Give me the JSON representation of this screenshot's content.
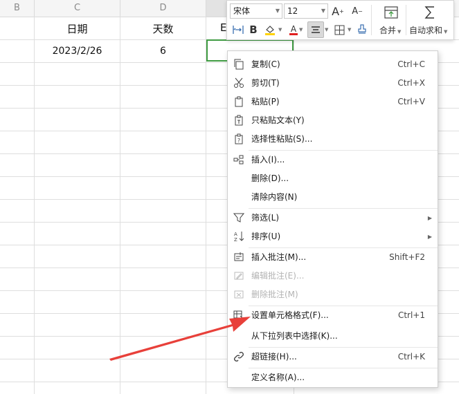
{
  "columns": {
    "b": "B",
    "c": "C",
    "d": "D"
  },
  "headers": {
    "date": "日期",
    "days": "天数",
    "partial": "E"
  },
  "row": {
    "date": "2023/2/26",
    "days": "6"
  },
  "toolbar": {
    "font_name": "宋体",
    "font_size": "12",
    "grow_font_glyph": "A",
    "shrink_font_glyph": "A",
    "bold_glyph": "B",
    "font_color_glyph": "A",
    "merge_label": "合并",
    "autosum_label": "自动求和",
    "font_color_bar": "#e02020",
    "fill_color_bar": "#ffd200"
  },
  "menu": {
    "items": [
      {
        "label": "复制(C)",
        "shortcut": "Ctrl+C"
      },
      {
        "label": "剪切(T)",
        "shortcut": "Ctrl+X"
      },
      {
        "label": "粘贴(P)",
        "shortcut": "Ctrl+V"
      },
      {
        "label": "只粘贴文本(Y)"
      },
      {
        "label": "选择性粘贴(S)..."
      },
      {
        "label": "插入(I)..."
      },
      {
        "label": "删除(D)..."
      },
      {
        "label": "清除内容(N)"
      },
      {
        "label": "筛选(L)"
      },
      {
        "label": "排序(U)"
      },
      {
        "label": "插入批注(M)...",
        "shortcut": "Shift+F2"
      },
      {
        "label": "编辑批注(E)..."
      },
      {
        "label": "删除批注(M)"
      },
      {
        "label": "设置单元格格式(F)...",
        "shortcut": "Ctrl+1"
      },
      {
        "label": "从下拉列表中选择(K)..."
      },
      {
        "label": "超链接(H)...",
        "shortcut": "Ctrl+K"
      },
      {
        "label": "定义名称(A)..."
      }
    ]
  },
  "colors": {
    "active_cell_border": "#3f9b42",
    "annotation_arrow": "#e8403a"
  }
}
